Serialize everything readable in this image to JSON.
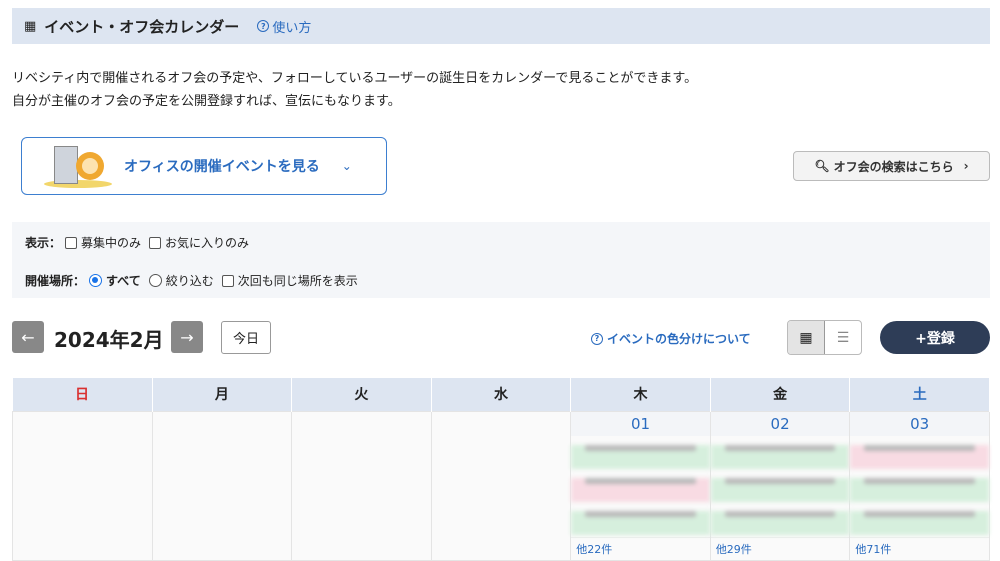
{
  "header": {
    "title": "イベント・オフ会カレンダー",
    "help_label": "使い方"
  },
  "description": [
    "リベシティ内で開催されるオフ会の予定や、フォローしているユーザーの誕生日をカレンダーで見ることができます。",
    "自分が主催のオフ会の予定を公開登録すれば、宣伝にもなります。"
  ],
  "office_button": {
    "label": "オフィスの開催イベントを見る"
  },
  "search_button": {
    "label": "オフ会の検索はこちら"
  },
  "filter": {
    "display_label": "表示：",
    "recruiting_only": "募集中のみ",
    "favorites_only": "お気に入りのみ",
    "location_label": "開催場所：",
    "all": "すべて",
    "narrow": "絞り込む",
    "same_next": "次回も同じ場所を表示",
    "recruiting_checked": false,
    "favorites_checked": false,
    "location_selected": "すべて",
    "same_next_checked": false
  },
  "nav": {
    "month": "2024年2月",
    "today": "今日",
    "color_info": "イベントの色分けについて",
    "register": "+登録",
    "active_view": "calendar"
  },
  "calendar": {
    "weekdays": [
      "日",
      "月",
      "火",
      "水",
      "木",
      "金",
      "土"
    ],
    "colors": {
      "sunday": "#d93030",
      "saturday": "#2a6bbf",
      "weekday": "#222222"
    },
    "days": [
      {
        "date": "01",
        "events": [
          "green",
          "pink",
          "green"
        ],
        "more": "他22件"
      },
      {
        "date": "02",
        "events": [
          "green",
          "green",
          "green"
        ],
        "more": "他29件"
      },
      {
        "date": "03",
        "events": [
          "pink",
          "green",
          "green"
        ],
        "more": "他71件"
      }
    ]
  }
}
